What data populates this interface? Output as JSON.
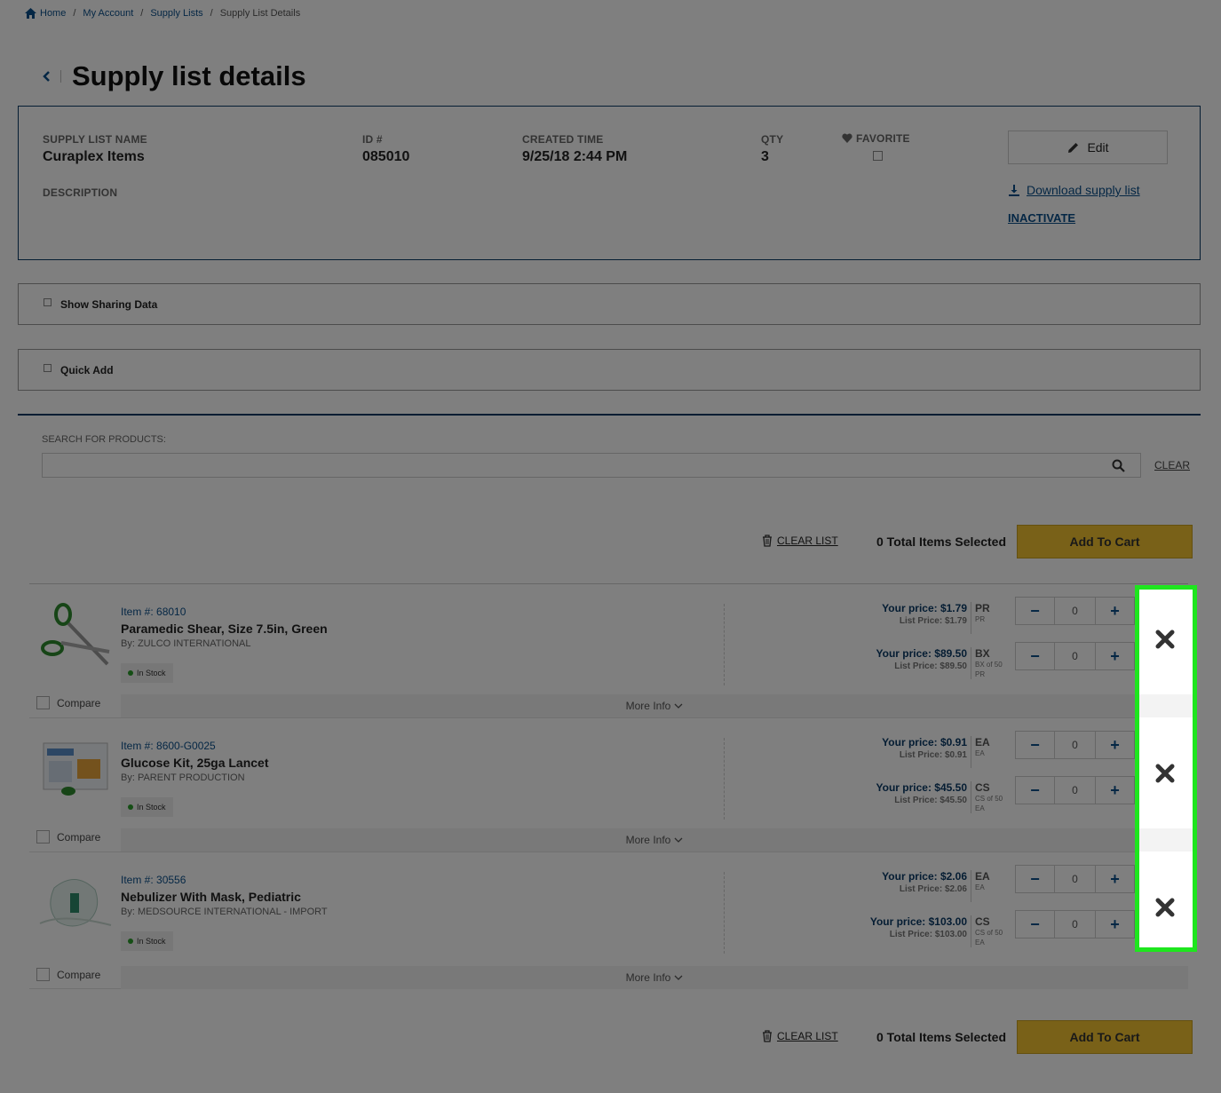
{
  "breadcrumb": {
    "items": [
      "Home",
      "My Account",
      "Supply Lists"
    ],
    "current": "Supply List Details",
    "separator": "/"
  },
  "page": {
    "title": "Supply list details"
  },
  "info": {
    "name_label": "SUPPLY LIST NAME",
    "name_value": "Curaplex Items",
    "id_label": "ID #",
    "id_value": "085010",
    "created_label": "CREATED TIME",
    "created_value": "9/25/18 2:44 PM",
    "qty_label": "QTY",
    "qty_value": "3",
    "favorite_label": "FAVORITE",
    "description_label": "DESCRIPTION",
    "edit_label": "Edit",
    "download_label": "Download supply list",
    "inactivate_label": "INACTIVATE"
  },
  "toggles": {
    "sharing": "Show Sharing Data",
    "quick_add": "Quick Add"
  },
  "search": {
    "label": "SEARCH FOR PRODUCTS:",
    "value": "",
    "clear_label": "CLEAR"
  },
  "actions": {
    "clear_list": "CLEAR LIST",
    "total_selected": "0 Total Items Selected",
    "add_to_cart": "Add To Cart"
  },
  "products": [
    {
      "item_number": "Item #: 68010",
      "name": "Paramedic Shear, Size 7.5in, Green",
      "brand": "By: ZULCO INTERNATIONAL",
      "stock": "In Stock",
      "compare": "Compare",
      "more_info": "More Info",
      "prices": [
        {
          "your_price": "Your price: $1.79",
          "list_price": "List Price: $1.79",
          "uom": "PR",
          "uom_sub": [
            "PR"
          ],
          "qty": "0"
        },
        {
          "your_price": "Your price: $89.50",
          "list_price": "List Price: $89.50",
          "uom": "BX",
          "uom_sub": [
            "BX of 50",
            "PR"
          ],
          "qty": "0"
        }
      ]
    },
    {
      "item_number": "Item #: 8600-G0025",
      "name": "Glucose Kit, 25ga Lancet",
      "brand": "By: PARENT PRODUCTION",
      "stock": "In Stock",
      "compare": "Compare",
      "more_info": "More Info",
      "prices": [
        {
          "your_price": "Your price: $0.91",
          "list_price": "List Price: $0.91",
          "uom": "EA",
          "uom_sub": [
            "EA"
          ],
          "qty": "0"
        },
        {
          "your_price": "Your price: $45.50",
          "list_price": "List Price: $45.50",
          "uom": "CS",
          "uom_sub": [
            "CS of 50",
            "EA"
          ],
          "qty": "0"
        }
      ]
    },
    {
      "item_number": "Item #: 30556",
      "name": "Nebulizer With Mask, Pediatric",
      "brand": "By: MEDSOURCE INTERNATIONAL - IMPORT",
      "stock": "In Stock",
      "compare": "Compare",
      "more_info": "More Info",
      "prices": [
        {
          "your_price": "Your price: $2.06",
          "list_price": "List Price: $2.06",
          "uom": "EA",
          "uom_sub": [
            "EA"
          ],
          "qty": "0"
        },
        {
          "your_price": "Your price: $103.00",
          "list_price": "List Price: $103.00",
          "uom": "CS",
          "uom_sub": [
            "CS of 50",
            "EA"
          ],
          "qty": "0"
        }
      ]
    }
  ],
  "colors": {
    "brand_blue": "#0b4f8a",
    "cart_yellow": "#f2c230",
    "highlight": "#1ee61e"
  }
}
